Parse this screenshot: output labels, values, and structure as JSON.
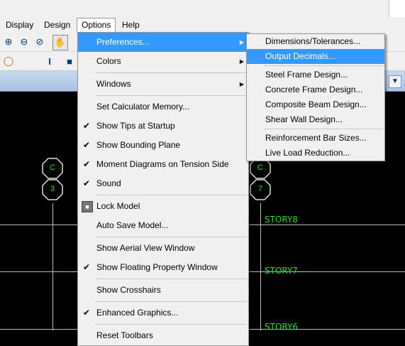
{
  "menubar": {
    "items": [
      "Display",
      "Design",
      "Options",
      "Help"
    ],
    "active": "Options"
  },
  "toolbar": {
    "row1": [
      "zoom-in",
      "zoom-out",
      "zoom-restore",
      "pan"
    ],
    "row2_label": "I"
  },
  "options_menu": {
    "items": [
      {
        "label": "Preferences...",
        "submenu": true,
        "highlight": true
      },
      {
        "label": "Colors",
        "submenu": true
      },
      {
        "sep": true
      },
      {
        "label": "Windows",
        "submenu": true
      },
      {
        "sep": true
      },
      {
        "label": "Set Calculator Memory..."
      },
      {
        "label": "Show Tips at Startup",
        "checked": true
      },
      {
        "label": "Show Bounding Plane",
        "checked": true
      },
      {
        "label": "Moment Diagrams on Tension Side",
        "checked": true
      },
      {
        "label": "Sound",
        "checked": true
      },
      {
        "sep": true
      },
      {
        "label": "Lock Model",
        "lock": true
      },
      {
        "label": "Auto Save Model..."
      },
      {
        "sep": true
      },
      {
        "label": "Show Aerial View Window"
      },
      {
        "label": "Show Floating Property Window",
        "checked": true
      },
      {
        "sep": true
      },
      {
        "label": "Show Crosshairs"
      },
      {
        "sep": true
      },
      {
        "label": "Enhanced Graphics...",
        "checked": true
      },
      {
        "sep": true
      },
      {
        "label": "Reset Toolbars"
      }
    ]
  },
  "preferences_submenu": {
    "items": [
      {
        "label": "Dimensions/Tolerances..."
      },
      {
        "label": "Output Decimals...",
        "highlight": true
      },
      {
        "sep": true
      },
      {
        "label": "Steel Frame Design..."
      },
      {
        "label": "Concrete Frame Design..."
      },
      {
        "label": "Composite Beam Design..."
      },
      {
        "label": "Shear Wall  Design..."
      },
      {
        "sep": true
      },
      {
        "label": "Reinforcement Bar Sizes..."
      },
      {
        "label": "Live Load Reduction..."
      }
    ]
  },
  "canvas": {
    "grid_bubbles": [
      {
        "letter": "C",
        "number": "3"
      },
      {
        "letter": "C",
        "number": "7"
      }
    ],
    "stories": [
      "STORY8",
      "STORY7",
      "STORY6"
    ]
  },
  "colors": {
    "highlight": "#3399ff",
    "story_text": "#22e022",
    "column_red": "#d01818"
  }
}
